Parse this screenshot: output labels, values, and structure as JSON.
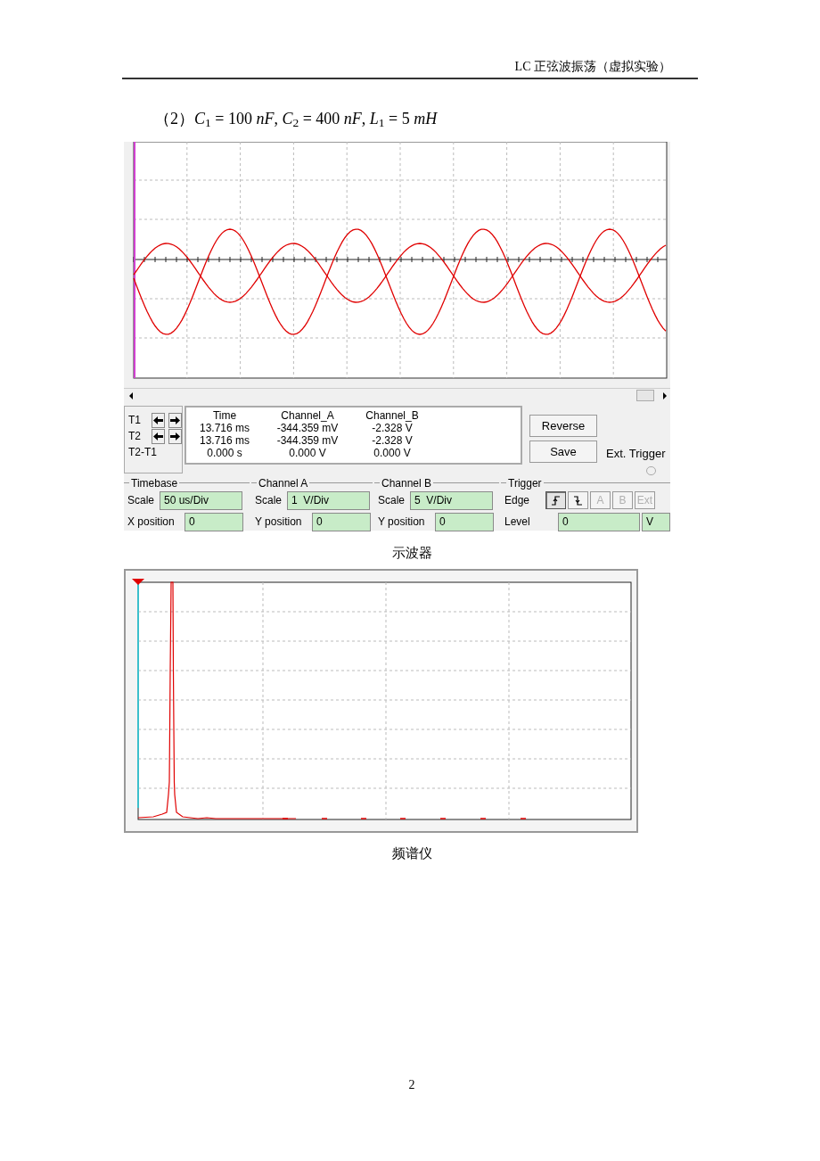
{
  "header": "LC 正弦波振荡（虚拟实验）",
  "formula": "（2）*C*$_{1}$ = 100 *nF*, *C*$_{2}$ = 400 *nF*, *L*$_{1}$ = 5 *mH*",
  "oscilloscope": {
    "cursors": [
      {
        "label": "T1",
        "arrows": true
      },
      {
        "label": "T2",
        "arrows": true
      },
      {
        "label": "T2-T1",
        "arrows": false
      }
    ],
    "readout": {
      "columns": [
        "Time",
        "Channel_A",
        "Channel_B"
      ],
      "rows": [
        [
          "13.716 ms",
          "-344.359 mV",
          "-2.328 V"
        ],
        [
          "13.716 ms",
          "-344.359 mV",
          "-2.328 V"
        ],
        [
          "0.000 s",
          "0.000 V",
          "0.000 V"
        ]
      ]
    },
    "buttons": [
      "Reverse",
      "Save"
    ],
    "ext_trigger": {
      "label": "Ext. Trigger",
      "selected": false
    },
    "groups": [
      {
        "title": "Timebase",
        "fields": [
          {
            "label": "Scale",
            "value": "50 us/Div"
          },
          {
            "label": "X position",
            "value": "0"
          }
        ]
      },
      {
        "title": "Channel A",
        "fields": [
          {
            "label": "Scale",
            "value": "1  V/Div"
          },
          {
            "label": "Y position",
            "value": "0"
          }
        ]
      },
      {
        "title": "Channel B",
        "fields": [
          {
            "label": "Scale",
            "value": "5  V/Div"
          },
          {
            "label": "Y position",
            "value": "0"
          }
        ]
      }
    ],
    "trigger": {
      "title": "Trigger",
      "edge_label": "Edge",
      "edge_buttons": [
        {
          "kind": "rising",
          "selected": true,
          "disabled": false
        },
        {
          "kind": "falling",
          "selected": false,
          "disabled": false
        },
        {
          "kind": "text",
          "label": "A",
          "selected": false,
          "disabled": true
        },
        {
          "kind": "text",
          "label": "B",
          "selected": false,
          "disabled": true
        },
        {
          "kind": "text",
          "label": "Ext",
          "selected": false,
          "disabled": true
        }
      ],
      "level_label": "Level",
      "level_value": "0",
      "level_unit": "V"
    }
  },
  "caption_1": "示波器",
  "caption_2": "频谱仪",
  "page_number": "2"
}
